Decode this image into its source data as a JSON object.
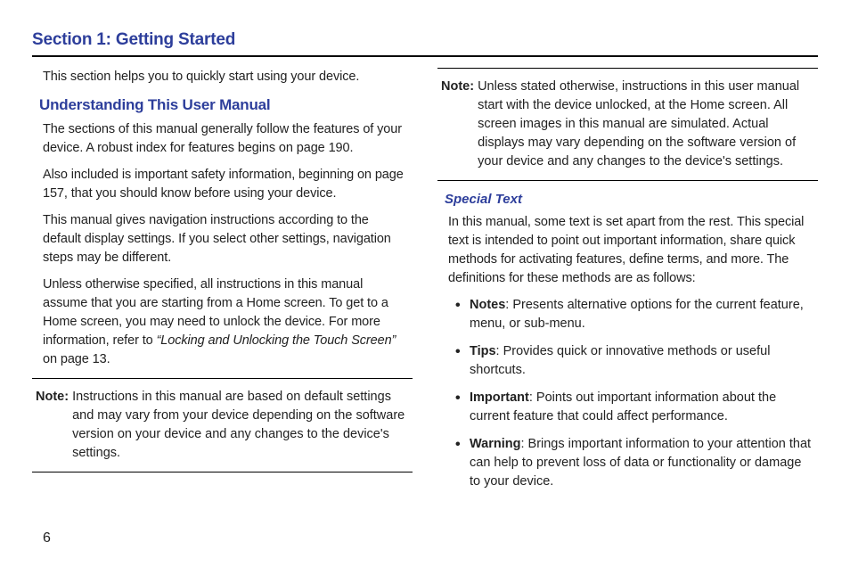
{
  "section_title": "Section 1: Getting Started",
  "page_number": "6",
  "left": {
    "intro": "This section helps you to quickly start using your device.",
    "heading": "Understanding This User Manual",
    "p1": "The sections of this manual generally follow the features of your device. A robust index for features begins on page 190.",
    "p2": "Also included is important safety information, beginning on page 157, that you should know before using your device.",
    "p3": "This manual gives navigation instructions according to the default display settings. If you select other settings, navigation steps may be different.",
    "p4_prefix": "Unless otherwise specified, all instructions in this manual assume that you are starting from a Home screen. To get to a Home screen, you may need to unlock the device. For more information, refer to ",
    "p4_ref": "“Locking and Unlocking the Touch Screen”",
    "p4_suffix": "  on page 13.",
    "note_label": "Note:",
    "note_body": "Instructions in this manual are based on default settings and may vary from your device depending on the software version on your device and any changes to the device's settings."
  },
  "right": {
    "note_label": "Note:",
    "note_body": "Unless stated otherwise, instructions in this user manual start with the device unlocked, at the Home screen. All screen images in this manual are simulated. Actual displays may vary depending on the software version of your device and any changes to the device's settings.",
    "heading": "Special Text",
    "intro": "In this manual, some text is set apart from the rest. This special text is intended to point out important information, share quick methods for activating features, define terms, and more. The definitions for these methods are as follows:",
    "bullets": [
      {
        "term": "Notes",
        "desc": ": Presents alternative options for the current feature, menu, or sub-menu."
      },
      {
        "term": "Tips",
        "desc": ": Provides quick or innovative methods or useful shortcuts."
      },
      {
        "term": "Important",
        "desc": ": Points out important information about the current feature that could affect performance."
      },
      {
        "term": "Warning",
        "desc": ": Brings important information to your attention that can help to prevent loss of data or functionality or damage to your device."
      }
    ]
  }
}
